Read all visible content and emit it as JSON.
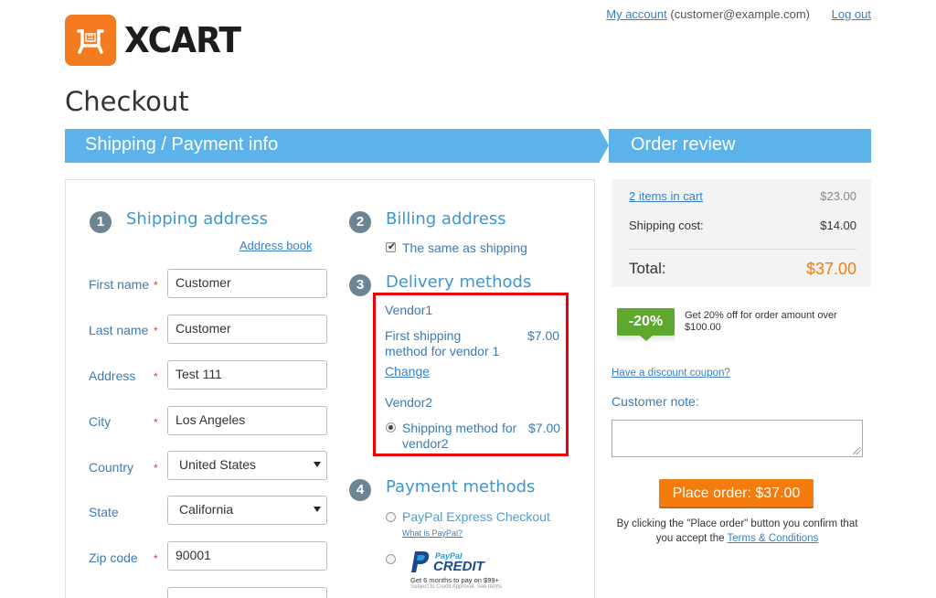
{
  "header": {
    "logo_text": "XCART",
    "my_account_label": "My account",
    "account_email": "(customer@example.com)",
    "logout_label": "Log out"
  },
  "page_title": "Checkout",
  "steps": {
    "step1_label": "Shipping / Payment info",
    "step2_label": "Order review"
  },
  "shipping": {
    "number": "1",
    "title": "Shipping address",
    "address_book_label": "Address book",
    "fields": {
      "first_name": {
        "label": "First name",
        "required": "*",
        "value": "Customer"
      },
      "last_name": {
        "label": "Last name",
        "required": "*",
        "value": "Customer"
      },
      "address": {
        "label": "Address",
        "required": "*",
        "value": "Test 111"
      },
      "city": {
        "label": "City",
        "required": "*",
        "value": "Los Angeles"
      },
      "country": {
        "label": "Country",
        "required": "*",
        "value": "United States"
      },
      "state": {
        "label": "State",
        "required": "",
        "value": "California"
      },
      "zip": {
        "label": "Zip code",
        "required": "*",
        "value": "90001"
      }
    }
  },
  "billing": {
    "number": "2",
    "title": "Billing address",
    "same_as_shipping_label": "The same as shipping",
    "same_as_shipping_checked": true
  },
  "delivery": {
    "number": "3",
    "title": "Delivery methods",
    "vendors": [
      {
        "name": "Vendor1",
        "method": "First shipping method for vendor 1",
        "method_line1": "First shipping",
        "method_line2": "method for vendor 1",
        "price": "$7.00",
        "change_label": "Change"
      },
      {
        "name": "Vendor2",
        "method": "Shipping method for vendor2",
        "method_line1": "Shipping method for",
        "method_line2": "vendor2",
        "price": "$7.00",
        "selected": true
      }
    ]
  },
  "payment": {
    "number": "4",
    "title": "Payment methods",
    "options": [
      {
        "label": "PayPal Express Checkout",
        "help_link": "What is PayPal?"
      },
      {
        "logo_word1": "PayPal",
        "logo_word2": "CREDIT",
        "promo": "Get 6 months to pay on $99+",
        "fineprint": "Subject to Credit Approval. See terms"
      }
    ]
  },
  "summary": {
    "items_label": "2 items in cart",
    "items_value": "$23.00",
    "shipping_label": "Shipping cost:",
    "shipping_value": "$14.00",
    "total_label": "Total:",
    "total_value": "$37.00"
  },
  "promo": {
    "badge": "-20%",
    "text_line1": "Get 20% off for order amount over",
    "text_line2": "$100.00"
  },
  "coupon_link": "Have a discount coupon?",
  "customer_note_label": "Customer note:",
  "place_order_label": "Place order: $37.00",
  "terms": {
    "line1": "By clicking the \"Place order\" button you confirm that",
    "line2_prefix": "you accept the ",
    "link": "Terms & Conditions"
  },
  "colors": {
    "brand_orange": "#f47b20",
    "step_blue": "#5cb3ea",
    "link_blue": "#3a7fc1",
    "total_orange": "#f47b0e",
    "promo_green": "#5fa82e",
    "highlight_red": "#e00000"
  }
}
